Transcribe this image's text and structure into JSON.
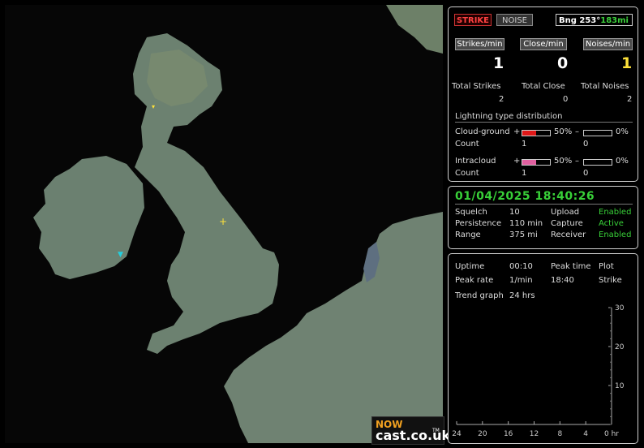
{
  "map": {
    "markers": [
      {
        "name": "strike-marker-north",
        "kind": "strike",
        "symbol": "+",
        "color": "#ffe23a"
      },
      {
        "name": "noise-marker",
        "kind": "noise",
        "symbol": "▼",
        "color": "#22d0e0"
      },
      {
        "name": "strike-marker-scotland",
        "kind": "strike",
        "symbol": "▾",
        "color": "#ffe23a"
      }
    ],
    "logo": {
      "now": "NOW",
      "cast": "cast.co.uk",
      "tm": "TM"
    }
  },
  "status_panel": {
    "strike_button": "STRIKE",
    "noise_button": "NOISE",
    "bearing_label": "Bng 253°",
    "distance_label": "183mi",
    "rates": [
      {
        "header": "Strikes/min",
        "value": "1"
      },
      {
        "header": "Close/min",
        "value": "0"
      },
      {
        "header": "Noises/min",
        "value": "1"
      }
    ],
    "totals": [
      {
        "label": "Total Strikes",
        "value": "2"
      },
      {
        "label": "Total Close",
        "value": "0"
      },
      {
        "label": "Total Noises",
        "value": "2"
      }
    ],
    "distribution": {
      "title": "Lightning type distribution",
      "rows": [
        {
          "label": "Cloud-ground",
          "plus": "+",
          "pos_pct": "50%",
          "pos_fill": 0.5,
          "pos_color": "#e01818",
          "minus": "–",
          "neg_pct": "0%",
          "neg_fill": 0,
          "count_label": "Count",
          "count_pos": "1",
          "count_neg": "0"
        },
        {
          "label": "Intracloud",
          "plus": "+",
          "pos_pct": "50%",
          "pos_fill": 0.5,
          "pos_color": "#e060a0",
          "minus": "–",
          "neg_pct": "0%",
          "neg_fill": 0,
          "count_label": "Count",
          "count_pos": "1",
          "count_neg": "0"
        }
      ]
    }
  },
  "settings_panel": {
    "datetime": "01/04/2025 18:40:26",
    "rows": [
      {
        "label": "Squelch",
        "value": "10",
        "label2": "Upload",
        "value2": "Enabled"
      },
      {
        "label": "Persistence",
        "value": "110 min",
        "label2": "Capture",
        "value2": "Active"
      },
      {
        "label": "Range",
        "value": "375 mi",
        "label2": "Receiver",
        "value2": "Enabled"
      }
    ]
  },
  "trend_panel": {
    "uptime_label": "Uptime",
    "uptime_value": "00:10",
    "peak_time_label": "Peak time",
    "peak_time_value": "18:40",
    "plot_label": "Plot",
    "plot_value": "Strike",
    "peak_rate_label": "Peak rate",
    "peak_rate_value": "1/min",
    "trend_label": "Trend graph",
    "trend_value": "24 hrs"
  },
  "chart_data": {
    "type": "line",
    "x_ticks": [
      "24",
      "20",
      "16",
      "12",
      "8",
      "4",
      "0 hr"
    ],
    "y_ticks": [
      "30",
      "20",
      "10"
    ],
    "ylim": [
      0,
      30
    ],
    "series": []
  }
}
